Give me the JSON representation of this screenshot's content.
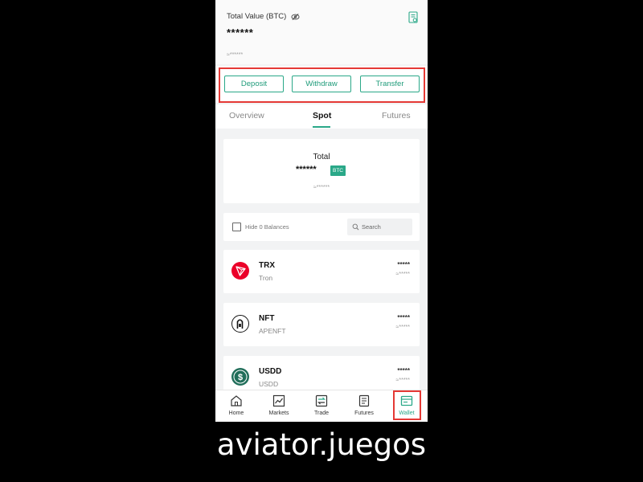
{
  "header": {
    "total_value_label": "Total Value (BTC)",
    "total_value": "******",
    "total_value_approx": "≈******",
    "icons": {
      "visibility": "eye-slash-icon",
      "statement": "statement-icon"
    }
  },
  "actions": {
    "deposit": "Deposit",
    "withdraw": "Withdraw",
    "transfer": "Transfer"
  },
  "tabs": [
    {
      "label": "Overview",
      "active": false
    },
    {
      "label": "Spot",
      "active": true
    },
    {
      "label": "Futures",
      "active": false
    }
  ],
  "spot_total": {
    "title": "Total",
    "value": "******",
    "currency": "BTC",
    "approx": "≈******"
  },
  "filter": {
    "hide_zero_label": "Hide 0 Balances",
    "hide_zero_checked": false,
    "search_placeholder": "Search"
  },
  "assets": [
    {
      "symbol": "TRX",
      "name": "Tron",
      "amount": "*****",
      "approx": "≈*****",
      "icon": "tron-icon",
      "color": "#eb0029"
    },
    {
      "symbol": "NFT",
      "name": "APENFT",
      "amount": "*****",
      "approx": "≈*****",
      "icon": "apenft-icon",
      "color": "#000000"
    },
    {
      "symbol": "USDD",
      "name": "USDD",
      "amount": "*****",
      "approx": "≈*****",
      "icon": "usdd-icon",
      "color": "#216e5a"
    }
  ],
  "bottom_nav": [
    {
      "label": "Home",
      "icon": "home-icon",
      "active": false
    },
    {
      "label": "Markets",
      "icon": "markets-icon",
      "active": false
    },
    {
      "label": "Trade",
      "icon": "trade-icon",
      "active": false
    },
    {
      "label": "Futures",
      "icon": "futures-icon",
      "active": false
    },
    {
      "label": "Wallet",
      "icon": "wallet-icon",
      "active": true
    }
  ],
  "colors": {
    "accent": "#2aa888",
    "highlight": "#e53935",
    "background": "#f2f3f4"
  },
  "watermark": "aviator.juegos"
}
